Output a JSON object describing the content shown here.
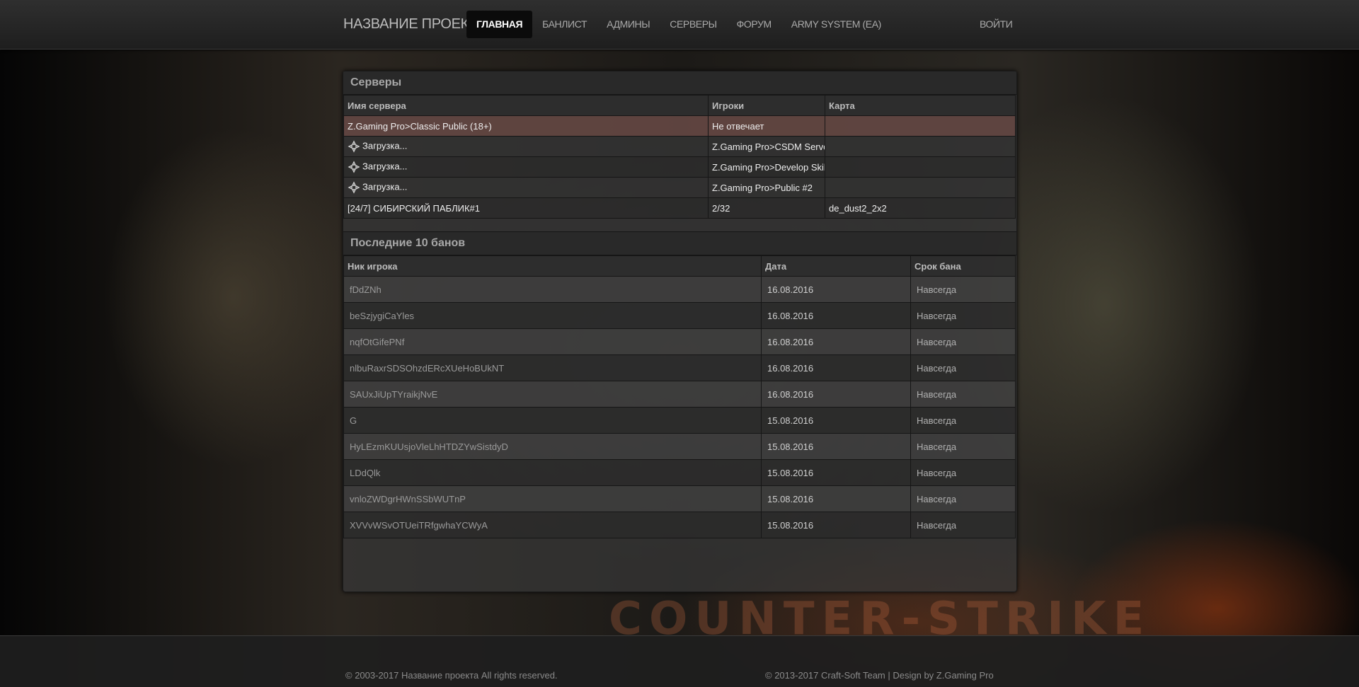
{
  "navbar": {
    "brand": "НАЗВАНИЕ ПРОЕКТА",
    "items": [
      {
        "label": "ГЛАВНАЯ",
        "active": true
      },
      {
        "label": "БАНЛИСТ",
        "active": false
      },
      {
        "label": "АДМИНЫ",
        "active": false
      },
      {
        "label": "СЕРВЕРЫ",
        "active": false
      },
      {
        "label": "ФОРУМ",
        "active": false
      },
      {
        "label": "ARMY SYSTEM (EA)",
        "active": false
      }
    ],
    "login": "ВОЙТИ"
  },
  "servers": {
    "title": "Серверы",
    "columns": [
      "Имя сервера",
      "Игроки",
      "Карта"
    ],
    "rows": [
      {
        "name": "Z.Gaming Pro>Classic Public (18+)",
        "players": "Не отвечает",
        "map": "",
        "status": "down",
        "loading": false
      },
      {
        "name": "Загрузка...",
        "players": "Z.Gaming Pro>CSDM Server",
        "map": "",
        "status": "loading",
        "loading": true
      },
      {
        "name": "Загрузка...",
        "players": "Z.Gaming Pro>Develop Skills",
        "map": "",
        "status": "loading",
        "loading": true
      },
      {
        "name": "Загрузка...",
        "players": "Z.Gaming Pro>Public #2",
        "map": "",
        "status": "loading",
        "loading": true
      },
      {
        "name": "[24/7] СИБИРСКИЙ ПАБЛИК#1",
        "players": "2/32",
        "map": "de_dust2_2x2",
        "status": "online",
        "loading": false
      }
    ]
  },
  "bans": {
    "title": "Последние 10 банов",
    "columns": [
      "Ник игрока",
      "Дата",
      "Срок бана"
    ],
    "rows": [
      {
        "nick": "fDdZNh",
        "date": "16.08.2016",
        "term": "Навсегда"
      },
      {
        "nick": "beSzjygiCaYles",
        "date": "16.08.2016",
        "term": "Навсегда"
      },
      {
        "nick": "nqfOtGifePNf",
        "date": "16.08.2016",
        "term": "Навсегда"
      },
      {
        "nick": "nlbuRaxrSDSOhzdERcXUeHoBUkNT",
        "date": "16.08.2016",
        "term": "Навсегда"
      },
      {
        "nick": "SAUxJiUpTYraikjNvE",
        "date": "16.08.2016",
        "term": "Навсегда"
      },
      {
        "nick": "G",
        "date": "15.08.2016",
        "term": "Навсегда"
      },
      {
        "nick": "HyLEzmKUUsjoVleLhHTDZYwSistdyD",
        "date": "15.08.2016",
        "term": "Навсегда"
      },
      {
        "nick": "LDdQlk",
        "date": "15.08.2016",
        "term": "Навсегда"
      },
      {
        "nick": "vnloZWDgrHWnSSbWUTnP",
        "date": "15.08.2016",
        "term": "Навсегда"
      },
      {
        "nick": "XVVvWSvOTUeiTRfgwhaYCWyA",
        "date": "15.08.2016",
        "term": "Навсегда"
      }
    ]
  },
  "footer": {
    "left": "© 2003-2017 Название проекта All rights reserved.",
    "right": "© 2013-2017 Craft-Soft Team | Design by Z.Gaming Pro"
  },
  "background_watermark": "COUNTER-STRIKE",
  "colors": {
    "navbar_bg": "#262626",
    "nav_active_bg": "#0b0b0b",
    "server_down_row": "#6e4b46",
    "panel_bg": "#373737"
  },
  "icons": {
    "loading": "loading-arrows-icon"
  }
}
